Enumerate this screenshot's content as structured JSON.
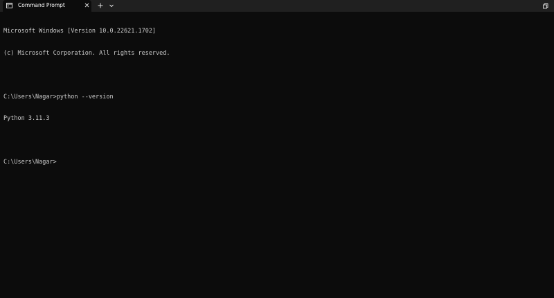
{
  "tab": {
    "title": "Command Prompt",
    "icon": "terminal-icon"
  },
  "tabbar": {
    "new_tab_icon": "plus-icon",
    "dropdown_icon": "chevron-down-icon",
    "close_icon": "close-icon",
    "restore_icon": "restore-icon"
  },
  "colors": {
    "background": "#0c0c0c",
    "tabbar": "#202020",
    "text": "#cccccc"
  },
  "console": {
    "lines": [
      "Microsoft Windows [Version 10.0.22621.1702]",
      "(c) Microsoft Corporation. All rights reserved.",
      "",
      "C:\\Users\\Nagar>python --version",
      "Python 3.11.3",
      "",
      "C:\\Users\\Nagar>"
    ]
  }
}
